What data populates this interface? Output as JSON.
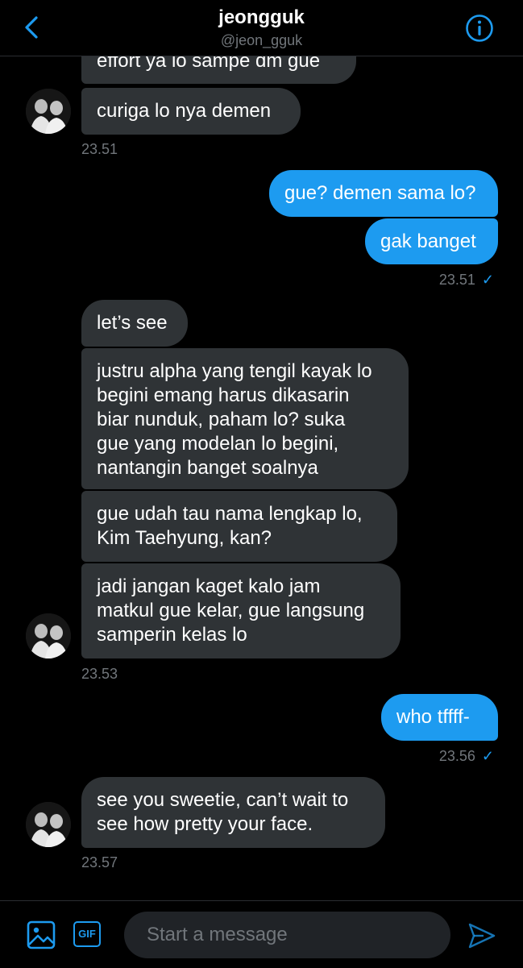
{
  "header": {
    "name": "jeongguk",
    "handle": "@jeon_gguk"
  },
  "messages": [
    {
      "from": "them",
      "text": "effort ya lo sampe dm gue"
    },
    {
      "from": "them",
      "text": "curiga lo nya demen"
    },
    {
      "time": "23.51"
    },
    {
      "from": "me",
      "text": "gue? demen sama lo?"
    },
    {
      "from": "me",
      "text": "gak banget"
    },
    {
      "time": "23.51",
      "read": true
    },
    {
      "from": "them",
      "text": "let’s see"
    },
    {
      "from": "them",
      "lines": [
        "justru alpha yang tengil kayak lo",
        "begini emang harus dikasarin",
        "biar nunduk, paham lo? suka",
        "gue yang modelan lo begini,",
        "nantangin banget soalnya"
      ]
    },
    {
      "from": "them",
      "lines": [
        "gue udah tau nama lengkap lo,",
        "Kim Taehyung, kan?"
      ]
    },
    {
      "from": "them",
      "lines": [
        "jadi jangan kaget kalo jam",
        "matkul gue kelar, gue langsung",
        "samperin kelas lo"
      ]
    },
    {
      "time": "23.53"
    },
    {
      "from": "me",
      "text": "who tffff-"
    },
    {
      "time": "23.56",
      "read": true
    },
    {
      "from": "them",
      "lines": [
        "see you sweetie, can’t wait to",
        "see how pretty your face."
      ]
    },
    {
      "time": "23.57"
    }
  ],
  "read_mark": "✓",
  "composer": {
    "placeholder": "Start a message",
    "gif_label": "GIF"
  },
  "colors": {
    "accent": "#1d9bf0",
    "received_bubble": "#2f3336",
    "muted_text": "#71767b"
  }
}
